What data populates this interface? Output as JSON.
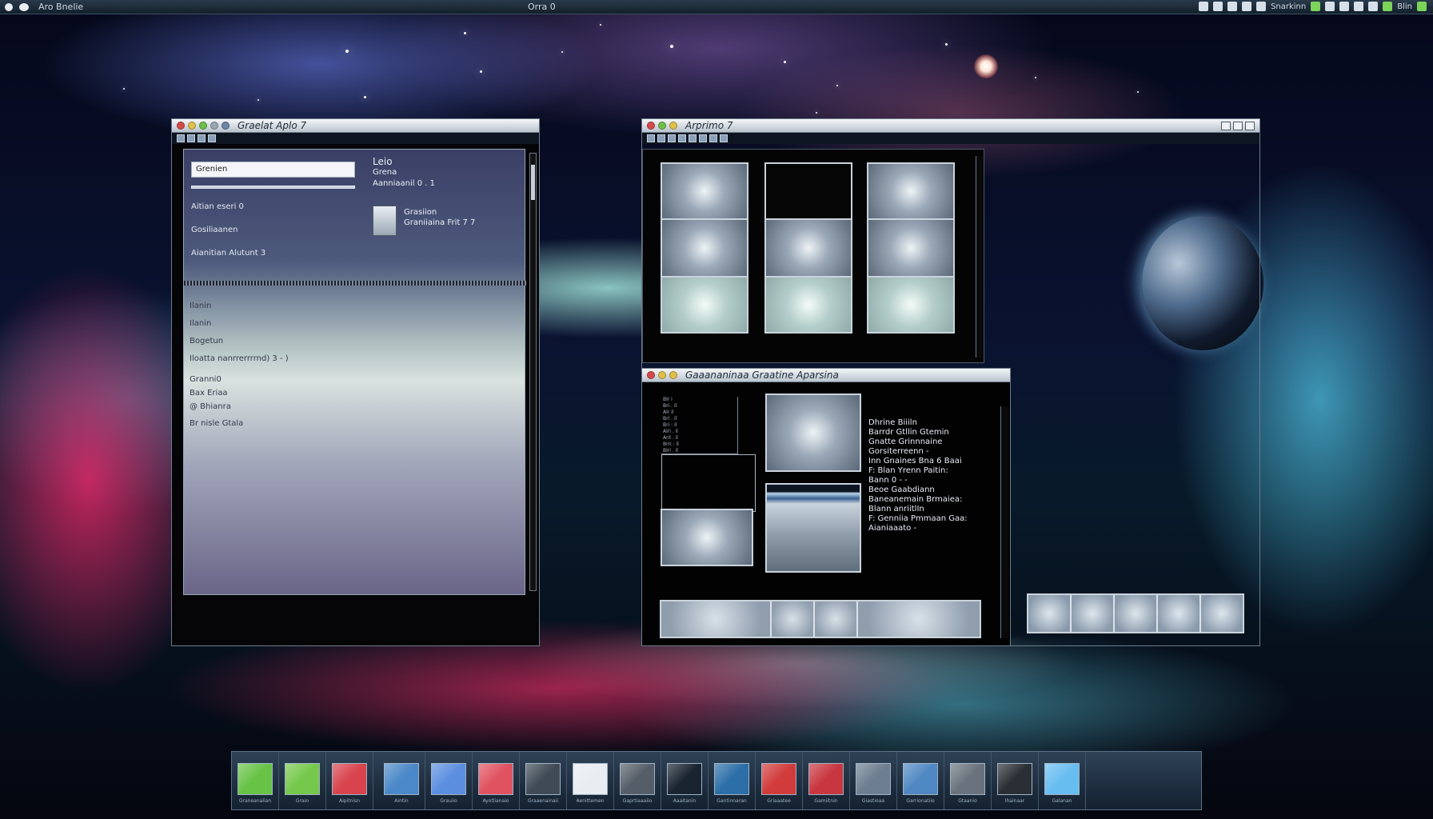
{
  "top_bar": {
    "app_menu": "Aro Bnelie",
    "window_title": "Orra 0",
    "tray_label": "Snarkinn",
    "tray_label_2": "Blin"
  },
  "window_1": {
    "title": "Graelat Aplo 7",
    "search_value": "Grenien",
    "list_items": [
      "Aitian  eseri 0",
      "Gosiliaanen",
      "Aianitian  Alutunt 3"
    ],
    "info_title": "Leio",
    "info_line_1": "Grena",
    "info_line_2": "Aanniaanil   0 . 1",
    "file_name": "Grasiion",
    "file_detail": "Graniiaina Frit  7 7",
    "menu_items": [
      "Ilanin",
      "Ilanin",
      "Bogetun",
      "Iloatta  nanrrerrrrnd)   3  -  )",
      "Granni0",
      "Bax  Eriaa",
      "@  Bhianra",
      "Br  nisle  Gtala"
    ]
  },
  "window_2": {
    "title": "Arprimo 7"
  },
  "window_3": {
    "title": "Gaaananinaa  Graatine  Aparsina",
    "mini_table": [
      "Blr  i",
      "Bri    .  il",
      "Alr       il",
      "Bri     .  il",
      "Bri    :  il",
      "Alri    .  il",
      "Aril   .  il",
      "Brri  :  il",
      "Blri   .  il"
    ],
    "properties": [
      "Dhrine  Biiiln",
      "Barrdr  Gtllin  Gtemin",
      "Gnatte  Grinnnaine",
      "Gorsiterreenn  -",
      "Inn  Gnaines   Bna  6  Baai",
      "F:  Blan  Yrenn  Paitin:",
      "Bann  0  -  -",
      "Beoe  Gaabdiann",
      "Baneanemain  Brmaiea:",
      "Blann  anriitlIn",
      "F:  Genniia  Pmmaan  Gaa:",
      "Aianiaaato  -"
    ]
  },
  "dock": {
    "items": [
      {
        "icon": "image-app-icon",
        "caption": "Graneanalian",
        "color": "#67c246"
      },
      {
        "icon": "circle-app-icon",
        "caption": "Graio",
        "color": "#76c84c"
      },
      {
        "icon": "red-square-app-icon",
        "caption": "Aipitnisn",
        "color": "#d8434d"
      },
      {
        "icon": "envelope-app-icon",
        "caption": "Aintin",
        "color": "#4a88c9"
      },
      {
        "icon": "blue-envelope-app-icon",
        "caption": "Grauiio",
        "color": "#5c8ee0"
      },
      {
        "icon": "mail-app-icon",
        "caption": "Ayotlianaio",
        "color": "#e05260"
      },
      {
        "icon": "sphere-app-icon",
        "caption": "Graaenainaii",
        "color": "#3f4a55"
      },
      {
        "icon": "white-square-app-icon",
        "caption": "Aenittemen",
        "color": "#e8edf2"
      },
      {
        "icon": "monitor-app-icon",
        "caption": "Gaprtiaaaiio",
        "color": "#555e68"
      },
      {
        "icon": "star-app-icon",
        "caption": "Aaaitanin",
        "color": "#1a2430"
      },
      {
        "icon": "butterfly-app-icon",
        "caption": "Gantinnaran",
        "color": "#2b6ea8"
      },
      {
        "icon": "cube-app-icon",
        "caption": "Griaaatee",
        "color": "#d13b3b"
      },
      {
        "icon": "folder-red-app-icon",
        "caption": "Gamiitnin",
        "color": "#c8363f"
      },
      {
        "icon": "triangle-app-icon",
        "caption": "Giastioaa",
        "color": "#6d7e90"
      },
      {
        "icon": "folder-app-icon",
        "caption": "Garrionatiio",
        "color": "#4f87c2"
      },
      {
        "icon": "speaker-app-icon",
        "caption": "Gtaanio",
        "color": "#6a737d"
      },
      {
        "icon": "camera-app-icon",
        "caption": "Ihainaar",
        "color": "#2a2f35"
      },
      {
        "icon": "prism-app-icon",
        "caption": "Galanan",
        "color": "#68bdf0"
      }
    ]
  }
}
